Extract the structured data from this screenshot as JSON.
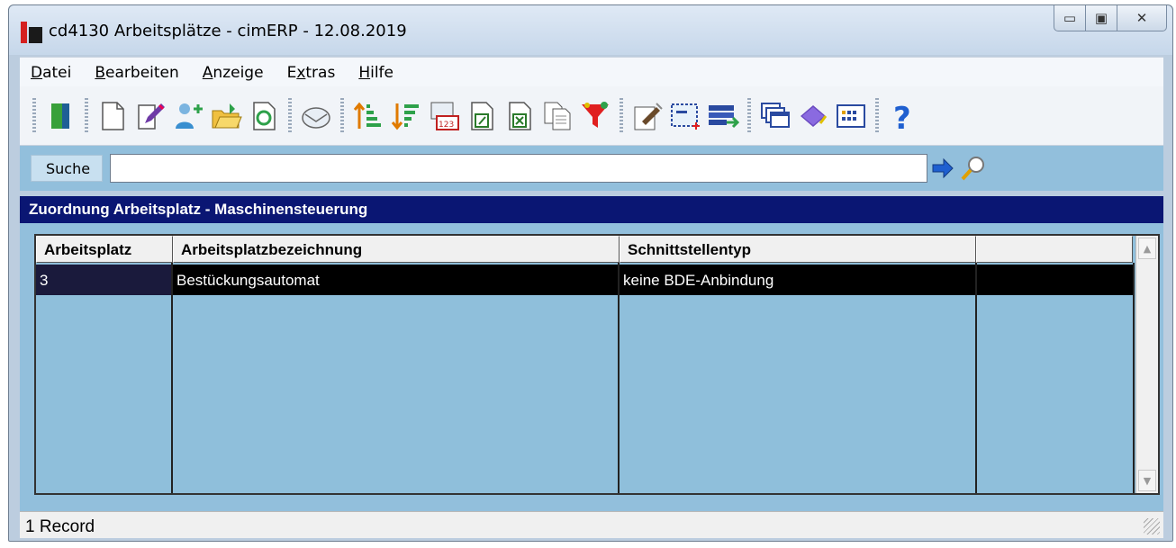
{
  "window": {
    "title": "cd4130 Arbeitsplätze - cimERP - 12.08.2019",
    "buttons": {
      "minimize": "▭",
      "maximize": "▣",
      "close": "✕"
    }
  },
  "menu": {
    "items": [
      {
        "label": "Datei",
        "mnemonic": "D",
        "rest": "atei"
      },
      {
        "label": "Bearbeiten",
        "mnemonic": "B",
        "rest": "earbeiten"
      },
      {
        "label": "Anzeige",
        "mnemonic": "A",
        "rest": "nzeige"
      },
      {
        "label": "Extras",
        "mnemonic": "x",
        "pre": "E",
        "rest": "tras"
      },
      {
        "label": "Hilfe",
        "mnemonic": "H",
        "rest": "ilfe"
      }
    ]
  },
  "toolbar": {
    "icons": [
      "exit-icon",
      "new-document-icon",
      "edit-icon",
      "user-add-icon",
      "folder-open-icon",
      "refresh-icon",
      "mail-icon",
      "sort-ascending-icon",
      "sort-descending-icon",
      "number-format-icon",
      "export-icon",
      "excel-export-icon",
      "copy-icon",
      "filter-icon",
      "properties-icon",
      "select-area-icon",
      "transfer-icon",
      "windows-icon",
      "book-icon",
      "calendar-icon",
      "help-icon"
    ]
  },
  "search": {
    "label": "Suche",
    "value": "",
    "placeholder": ""
  },
  "section": {
    "title": "Zuordnung Arbeitsplatz - Maschinensteuerung"
  },
  "grid": {
    "columns": [
      "Arbeitsplatz",
      "Arbeitsplatzbezeichnung",
      "Schnittstellentyp",
      ""
    ],
    "rows": [
      [
        "3",
        "Bestückungsautomat",
        "keine BDE-Anbindung",
        ""
      ]
    ]
  },
  "status": {
    "text": "1 Record"
  },
  "colors": {
    "section_bg": "#0a1673",
    "grid_bg": "#8fbfdb",
    "selected_row": "#000000"
  }
}
